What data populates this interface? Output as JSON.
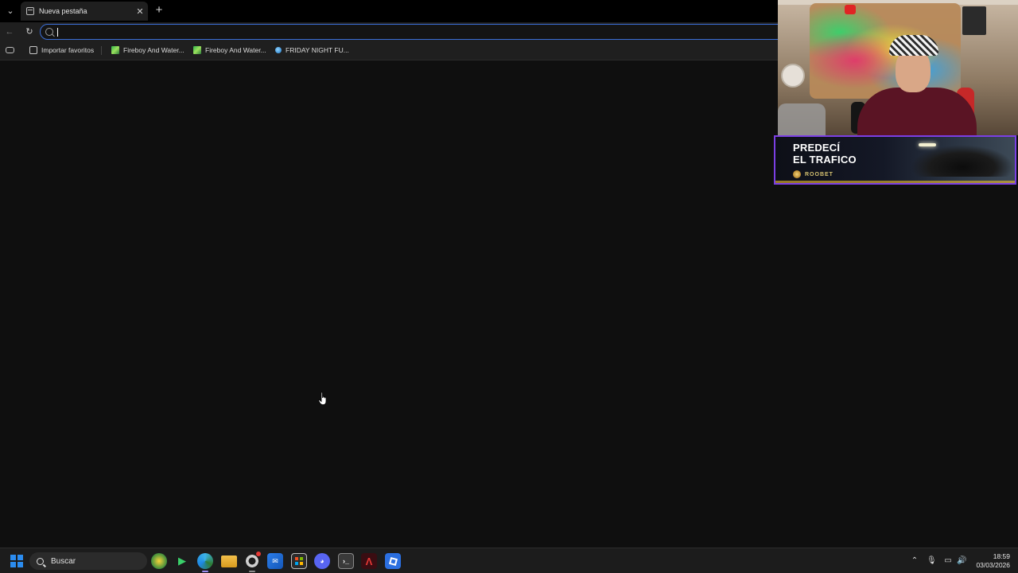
{
  "browser": {
    "tab": {
      "title": "Nueva pestaña",
      "favicon": "new-tab-page-icon",
      "close_glyph": "✕"
    },
    "new_tab_glyph": "+",
    "tab_menu_glyph": "⌄",
    "toolbar": {
      "back_glyph": "←",
      "reload_glyph": "↻",
      "address_value": "",
      "address_placeholder": ""
    },
    "bookmarks": [
      {
        "label": "Importar favoritos",
        "icon": "import-icon"
      },
      {
        "label": "Fireboy And Water...",
        "icon": "fireboy-watergirl-icon"
      },
      {
        "label": "Fireboy And Water...",
        "icon": "fireboy-watergirl-icon"
      },
      {
        "label": "FRIDAY NIGHT FU...",
        "icon": "friday-night-funkin-icon"
      }
    ]
  },
  "overlay": {
    "ad": {
      "headline_line1": "PREDECÍ",
      "headline_line2": "EL TRAFICO",
      "brand": "ROOBET"
    }
  },
  "taskbar": {
    "search_label": "Buscar",
    "time": "18:59",
    "date": "03/03/2026",
    "apps": [
      "game-launcher-icon",
      "media-player-icon",
      "edge-browser-icon",
      "file-explorer-icon",
      "obs-icon",
      "mail-icon",
      "microsoft-store-icon",
      "discord-icon",
      "terminal-icon",
      "adobe-acrobat-icon",
      "roblox-studio-icon"
    ],
    "tray": [
      "show-hidden-icons-icon",
      "microphone-icon",
      "network-icon",
      "volume-icon"
    ]
  },
  "colors": {
    "accent": "#3b6fd8",
    "page_bg": "#0f0f0f",
    "toolbar_bg": "#1f1f1f",
    "ad_border": "#7b3fe4"
  }
}
